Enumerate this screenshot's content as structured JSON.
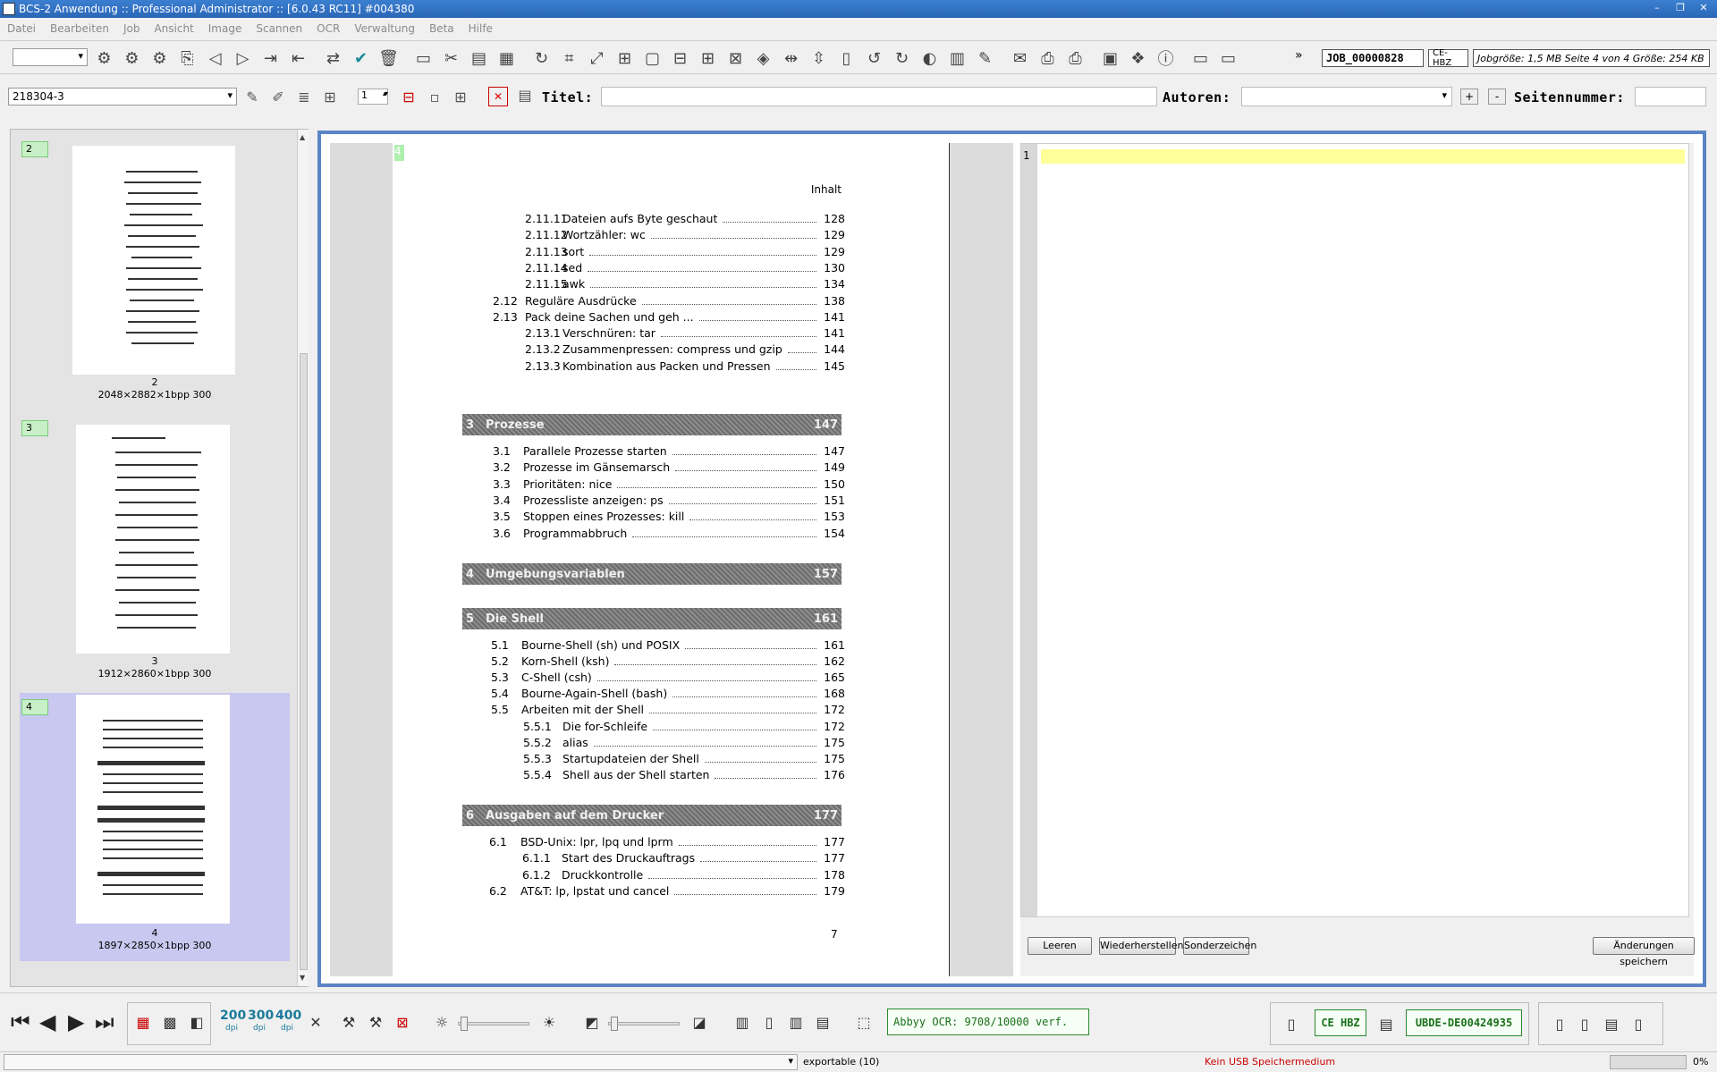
{
  "window": {
    "title": "BCS-2 Anwendung :: Professional Administrator :: [6.0.43 RC11]  #004380",
    "controls": [
      "–",
      "❐",
      "✕"
    ]
  },
  "menu": [
    "Datei",
    "Bearbeiten",
    "Job",
    "Ansicht",
    "Image",
    "Scannen",
    "OCR",
    "Verwaltung",
    "Beta",
    "Hilfe"
  ],
  "toolbar": {
    "job_id": "JOB_00000828",
    "org": "CE-HBZ",
    "job_info": "Jobgröße: 1,5 MB Seite 4 von 4 Größe: 254 KB",
    "more": "»"
  },
  "metadata_bar": {
    "document": "218304-3",
    "page_spin": "1",
    "titel_label": "Titel:",
    "titel_value": "",
    "autoren_label": "Autoren:",
    "autoren_value": "",
    "plus": "+",
    "minus": "-",
    "seiten_label": "Seitennummer:",
    "seiten_value": ""
  },
  "thumbnails": [
    {
      "num": "2",
      "caption_num": "2",
      "info": "2048×2882×1bpp 300"
    },
    {
      "num": "3",
      "caption_num": "3",
      "info": "1912×2860×1bpp 300"
    },
    {
      "num": "4",
      "caption_num": "4",
      "info": "1897×2850×1bpp 300"
    }
  ],
  "scan": {
    "badge": "4",
    "header": "Inhalt",
    "footer": "7",
    "toc_a": [
      {
        "num": "2.11.11",
        "title": "Dateien aufs Byte geschaut",
        "page": "128"
      },
      {
        "num": "2.11.12",
        "title": "Wortzähler: wc",
        "page": "129"
      },
      {
        "num": "2.11.13",
        "title": "sort",
        "page": "129"
      },
      {
        "num": "2.11.14",
        "title": "sed",
        "page": "130"
      },
      {
        "num": "2.11.15",
        "title": "awk",
        "page": "134"
      },
      {
        "num": "2.12",
        "title": "Reguläre Ausdrücke",
        "page": "138"
      },
      {
        "num": "2.13",
        "title": "Pack deine Sachen und geh ...",
        "page": "141"
      },
      {
        "num": "2.13.1",
        "title": "Verschnüren: tar",
        "page": "141"
      },
      {
        "num": "2.13.2",
        "title": "Zusammenpressen: compress und gzip",
        "page": "144"
      },
      {
        "num": "2.13.3",
        "title": "Kombination aus Packen und Pressen",
        "page": "145"
      }
    ],
    "chapters": [
      {
        "num": "3",
        "title": "Prozesse",
        "page": "147"
      },
      {
        "num": "4",
        "title": "Umgebungsvariablen",
        "page": "157"
      },
      {
        "num": "5",
        "title": "Die Shell",
        "page": "161"
      },
      {
        "num": "6",
        "title": "Ausgaben auf dem Drucker",
        "page": "177"
      }
    ],
    "toc_3": [
      {
        "num": "3.1",
        "title": "Parallele Prozesse starten",
        "page": "147"
      },
      {
        "num": "3.2",
        "title": "Prozesse im Gänsemarsch",
        "page": "149"
      },
      {
        "num": "3.3",
        "title": "Prioritäten: nice",
        "page": "150"
      },
      {
        "num": "3.4",
        "title": "Prozessliste anzeigen: ps",
        "page": "151"
      },
      {
        "num": "3.5",
        "title": "Stoppen eines Prozesses: kill",
        "page": "153"
      },
      {
        "num": "3.6",
        "title": "Programmabbruch",
        "page": "154"
      }
    ],
    "toc_5": [
      {
        "num": "5.1",
        "title": "Bourne-Shell (sh) und POSIX",
        "page": "161"
      },
      {
        "num": "5.2",
        "title": "Korn-Shell (ksh)",
        "page": "162"
      },
      {
        "num": "5.3",
        "title": "C-Shell (csh)",
        "page": "165"
      },
      {
        "num": "5.4",
        "title": "Bourne-Again-Shell (bash)",
        "page": "168"
      },
      {
        "num": "5.5",
        "title": "Arbeiten mit der Shell",
        "page": "172"
      },
      {
        "num": "5.5.1",
        "title": "Die for-Schleife",
        "page": "172"
      },
      {
        "num": "5.5.2",
        "title": "alias",
        "page": "175"
      },
      {
        "num": "5.5.3",
        "title": "Startupdateien der Shell",
        "page": "175"
      },
      {
        "num": "5.5.4",
        "title": "Shell aus der Shell starten",
        "page": "176"
      }
    ],
    "toc_6": [
      {
        "num": "6.1",
        "title": "BSD-Unix: lpr, lpq und lprm",
        "page": "177"
      },
      {
        "num": "6.1.1",
        "title": "Start des Druckauftrags",
        "page": "177"
      },
      {
        "num": "6.1.2",
        "title": "Druckkontrolle",
        "page": "178"
      },
      {
        "num": "6.2",
        "title": "AT&T: lp, lpstat und cancel",
        "page": "179"
      }
    ]
  },
  "ocr_editor": {
    "line_number": "1",
    "buttons": {
      "leeren": "Leeren",
      "wiederherstellen": "Wiederherstellen",
      "sonderzeichen": "Sonderzeichen",
      "save": "Änderungen speichern"
    }
  },
  "bottom": {
    "dpi": [
      {
        "value": "200",
        "unit": "dpi"
      },
      {
        "value": "300",
        "unit": "dpi"
      },
      {
        "value": "400",
        "unit": "dpi"
      }
    ],
    "ocr_status": "Abbyy OCR: 9708/10000 verf.",
    "ce_hbz": "CE HBZ",
    "ubde": "UBDE-DE00424935"
  },
  "status": {
    "export": "exportable (10)",
    "usb": "Kein USB Speichermedium",
    "progress_pct": "0%",
    "progress_value": 0
  }
}
